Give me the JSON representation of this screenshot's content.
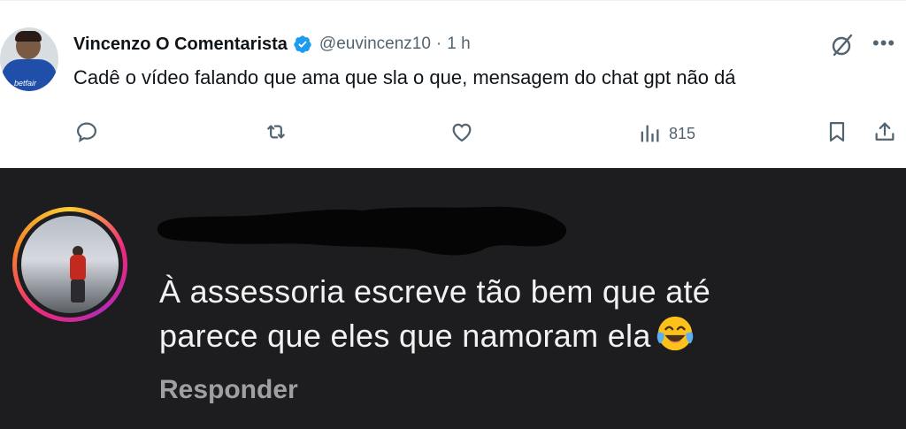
{
  "tweet": {
    "author_name": "Vincenzo O Comentarista",
    "handle": "@euvincenz10",
    "separator": "·",
    "time": "1 h",
    "text": "Cadê o vídeo falando que ama que sla o que, mensagem do chat gpt não dá",
    "avatar_sponsor": "betfair",
    "views": "815",
    "icons": [
      "verified-badge-icon",
      "grok-icon",
      "more-icon",
      "reply-icon",
      "retweet-icon",
      "like-icon",
      "views-icon",
      "bookmark-icon",
      "share-icon"
    ],
    "colors": {
      "verified": "#1d9bf0",
      "text": "#0f1419",
      "muted": "#536471"
    }
  },
  "comment": {
    "text_line1": "À assessoria escreve tão bem que até",
    "text_line2": "parece que eles que namoram ela",
    "emoji": "face-with-tears-of-joy",
    "reply_label": "Responder",
    "username_redacted": true,
    "colors": {
      "background": "#1d1d20",
      "text": "#f2f2f2",
      "muted": "#a0a0a3"
    }
  }
}
